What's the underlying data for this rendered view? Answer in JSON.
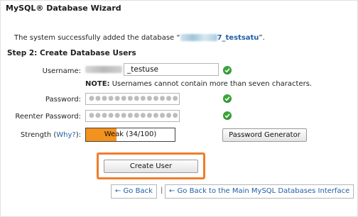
{
  "title": "MySQL® Database Wizard",
  "success": {
    "prefix": "The system successfully added the database “",
    "db_suffix": "7_testsatu",
    "suffix": "”."
  },
  "step_heading": "Step 2: Create Database Users",
  "username": {
    "label": "Username:",
    "value": "_testuse"
  },
  "note": {
    "bold": "NOTE:",
    "text": " Usernames cannot contain more than seven characters."
  },
  "password": {
    "label": "Password:",
    "masked": "●●●●●●●●●●●●●●●●●●●●"
  },
  "reenter": {
    "label": "Reenter Password:",
    "masked": "●●●●●●●●●●●●●●●●●●●●"
  },
  "strength": {
    "label_prefix": "Strength (",
    "why_link": "Why?",
    "label_suffix": "):",
    "text": "Weak (34/100)",
    "score": 34
  },
  "buttons": {
    "password_generator": "Password Generator",
    "create_user": "Create User"
  },
  "nav": {
    "go_back": "← Go Back",
    "separator": "|",
    "go_back_main": "← Go Back to the Main MySQL Databases Interface"
  },
  "colors": {
    "accent_orange": "#f07d2b",
    "strength_fill": "#f4921e",
    "check_green": "#3aa63a",
    "link_blue": "#1f5fa6"
  },
  "icons": {
    "valid": "check-circle-icon"
  }
}
